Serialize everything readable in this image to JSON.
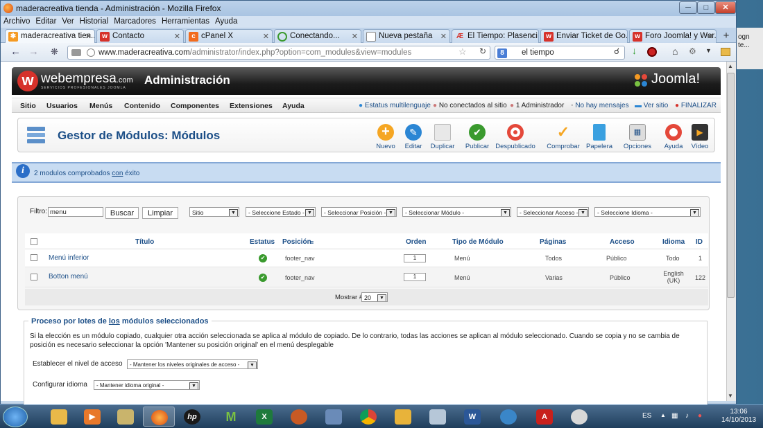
{
  "desktop_side_text": "ogn\nte...",
  "window": {
    "title": "maderacreativa tienda - Administración - Mozilla Firefox",
    "controls": [
      "minimize",
      "maximize",
      "close"
    ]
  },
  "menubar": [
    "Archivo",
    "Editar",
    "Ver",
    "Historial",
    "Marcadores",
    "Herramientas",
    "Ayuda"
  ],
  "tabs": [
    {
      "label": "maderacreativa tien...",
      "icon": "joomla-favicon",
      "active": true
    },
    {
      "label": "Contacto",
      "icon": "webempresa-favicon",
      "active": false
    },
    {
      "label": "cPanel X",
      "icon": "cpanel-favicon",
      "active": false
    },
    {
      "label": "Conectando...",
      "icon": "loading-icon",
      "active": false
    },
    {
      "label": "Nueva pestaña",
      "icon": "blank-page-icon",
      "active": false
    },
    {
      "label": "El Tiempo: Plasenci...",
      "icon": "eltiempo-favicon",
      "active": false
    },
    {
      "label": "Enviar Ticket de Co...",
      "icon": "webempresa-favicon",
      "active": false
    },
    {
      "label": "Foro Joomla! y Wor...",
      "icon": "webempresa-favicon",
      "active": false
    }
  ],
  "nav": {
    "url_domain": "www.maderacreativa.com",
    "url_path": "/administrator/index.php?option=com_modules&view=modules",
    "search_value": "el tiempo"
  },
  "header": {
    "brand": "webempresa",
    "brand_suffix": ".com",
    "brand_tagline": "SERVICIOS PROFESIONALES JOOMLA",
    "title": "Administración",
    "joomla_logo": "Joomla!"
  },
  "submenu": {
    "items": [
      "Sitio",
      "Usuarios",
      "Menús",
      "Contenido",
      "Componentes",
      "Extensiones",
      "Ayuda"
    ],
    "status": [
      {
        "label": "Estatus multilenguaje",
        "icon": "globe-icon"
      },
      {
        "label": "No conectados al sitio",
        "icon": "users-icon"
      },
      {
        "label": "1 Administrador",
        "icon": "admin-icon"
      },
      {
        "label": "No hay mensajes",
        "icon": "message-icon"
      },
      {
        "label": "Ver sitio",
        "icon": "screen-icon"
      },
      {
        "label": "FINALIZAR",
        "icon": "logout-icon"
      }
    ]
  },
  "toolbar": {
    "title": "Gestor de Módulos: Módulos",
    "buttons": [
      {
        "label": "Nuevo",
        "icon": "new-icon",
        "color": "#f5a623"
      },
      {
        "label": "Editar",
        "icon": "edit-icon",
        "color": "#2b86d4"
      },
      {
        "label": "Duplicar",
        "icon": "copy-icon",
        "color": "#cccccc"
      },
      {
        "label": "Publicar",
        "icon": "publish-icon",
        "color": "#3a9a2e"
      },
      {
        "label": "Despublicado",
        "icon": "unpublish-icon",
        "color": "#e4483a"
      },
      {
        "label": "Comprobar",
        "icon": "check-icon",
        "color": "#f5a623"
      },
      {
        "label": "Papelera",
        "icon": "trash-icon",
        "color": "#3aa0e0"
      },
      {
        "label": "Opciones",
        "icon": "options-icon",
        "color": "#bbbbbb"
      },
      {
        "label": "Ayuda",
        "icon": "help-icon",
        "color": "#e4483a"
      },
      {
        "label": "Vídeo",
        "icon": "video-icon",
        "color": "#444444"
      }
    ]
  },
  "message": {
    "pre": "2 modulos comprobados ",
    "link": "con",
    "post": " éxito"
  },
  "filters": {
    "label": "Filtro:",
    "value": "menu",
    "search_button": "Buscar",
    "clear_button": "Limpiar",
    "selects": [
      "Sitio",
      "- Seleccione Estado -",
      "- Seleccionar Posición -",
      "- Seleccionar Módulo -",
      "- Seleccionar Acceso -",
      "- Seleccione Idioma -"
    ]
  },
  "table": {
    "headers": [
      "Título",
      "Estatus",
      "Posición",
      "Orden",
      "Tipo de Módulo",
      "Páginas",
      "Acceso",
      "Idioma",
      "ID"
    ],
    "rows": [
      {
        "title": "Menú inferior",
        "position": "footer_nav",
        "order": "1",
        "type": "Menú",
        "pages": "Todos",
        "access": "Público",
        "language": "Todo",
        "id": "1"
      },
      {
        "title": "Botton menú",
        "position": "footer_nav",
        "order": "1",
        "type": "Menú",
        "pages": "Varias",
        "access": "Público",
        "language": "English (UK)",
        "id": "122"
      }
    ],
    "show_label": "Mostrar #",
    "show_value": "20"
  },
  "batch": {
    "legend_pre": "Proceso por lotes de ",
    "legend_link": "los",
    "legend_post": " módulos seleccionados",
    "description": "Si la elección es un módulo copiado, cualquier otra acción seleccionada se aplica al módulo de copiado. De lo contrario, todas las acciones se aplican al módulo seleccionado. Cuando se copia y no se cambia de posición es necesario seleccionar la opción 'Mantener su posición original' en el menú desplegable",
    "access_label": "Establecer el nivel de acceso",
    "access_value": "- Mantener los niveles originales de acceso -",
    "language_label": "Configurar idioma",
    "language_value": "- Mantener idioma original -"
  },
  "taskbar": {
    "apps": [
      "explorer",
      "media-player",
      "folder-tools",
      "firefox",
      "hp",
      "movistar",
      "excel",
      "game",
      "calendar-app",
      "chrome",
      "notes",
      "calculator",
      "word",
      "messenger",
      "acrobat",
      "paint"
    ],
    "lang": "ES",
    "time": "13:06",
    "date": "14/10/2013"
  }
}
